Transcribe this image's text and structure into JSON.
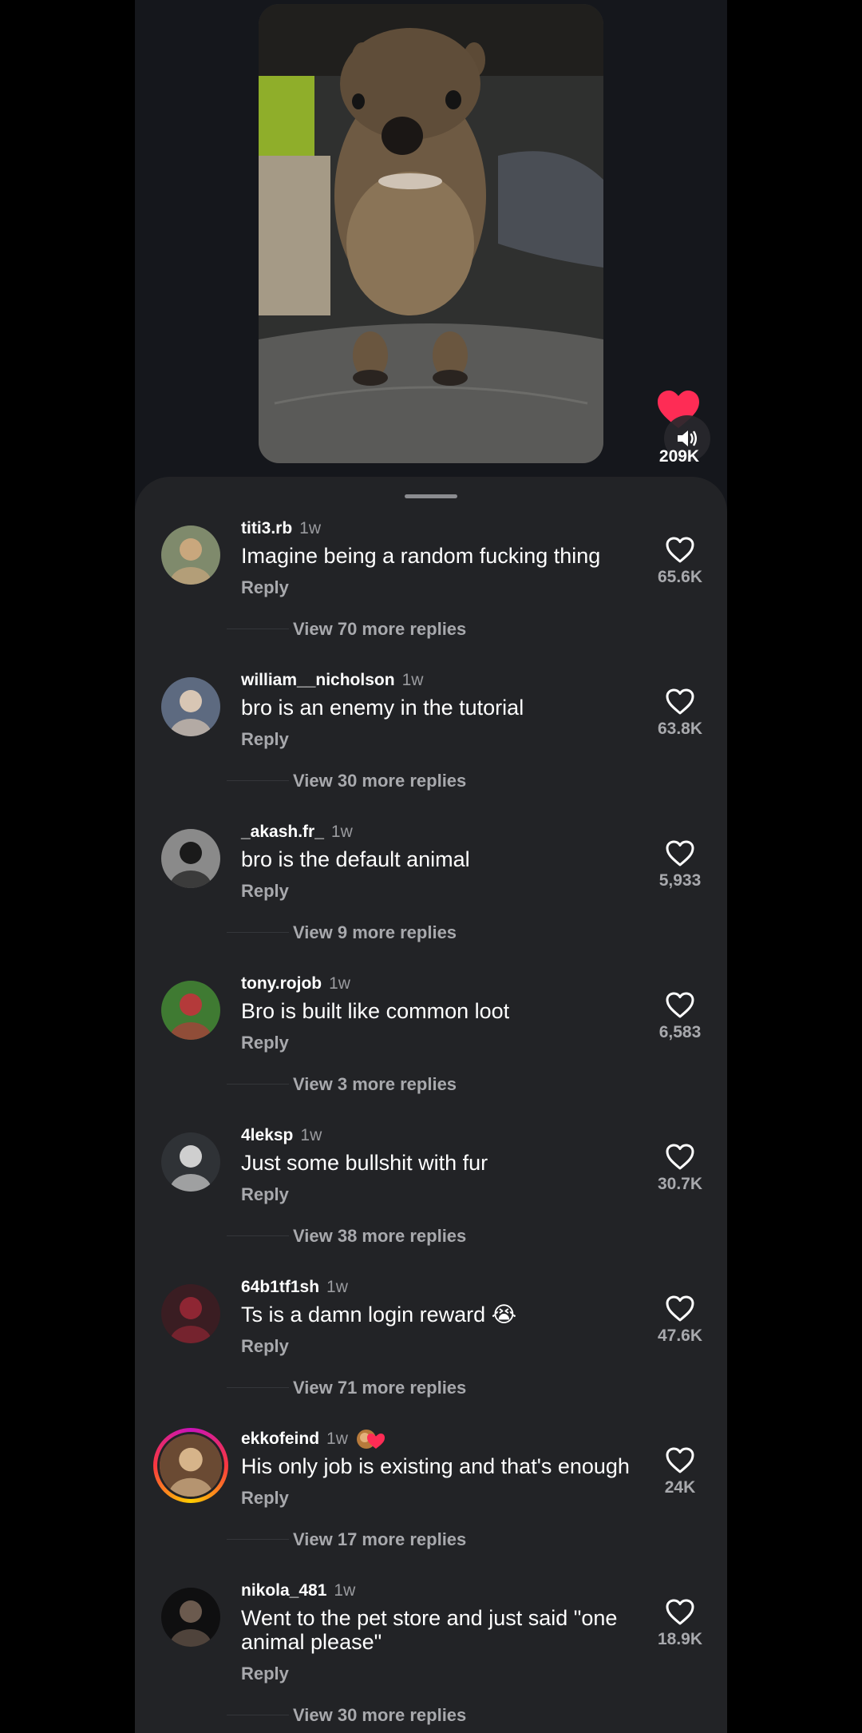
{
  "video": {
    "likes": "209K",
    "icons": {
      "heart": "heart-icon",
      "sound": "speaker-icon"
    },
    "colors": {
      "heart": "#fe2c55"
    }
  },
  "comments": [
    {
      "user": "titi3.rb",
      "time": "1w",
      "text": "Imagine being a random fucking thing",
      "reply": "Reply",
      "likes": "65.6K",
      "view_more": "View 70 more replies"
    },
    {
      "user": "william__nicholson",
      "time": "1w",
      "text": "bro is an enemy in the tutorial",
      "reply": "Reply",
      "likes": "63.8K",
      "view_more": "View 30 more replies"
    },
    {
      "user": "_akash.fr_",
      "time": "1w",
      "text": "bro is the default animal",
      "reply": "Reply",
      "likes": "5,933",
      "view_more": "View 9 more replies"
    },
    {
      "user": "tony.rojob",
      "time": "1w",
      "text": "Bro is built like common loot",
      "reply": "Reply",
      "likes": "6,583",
      "view_more": "View 3 more replies"
    },
    {
      "user": "4leksp",
      "time": "1w",
      "text": "Just some bullshit with fur",
      "reply": "Reply",
      "likes": "30.7K",
      "view_more": "View 38 more replies"
    },
    {
      "user": "64b1tf1sh",
      "time": "1w",
      "text": "Ts is a damn login reward 😭",
      "reply": "Reply",
      "likes": "47.6K",
      "view_more": "View 71 more replies"
    },
    {
      "user": "ekkofeind",
      "time": "1w",
      "text": "His only job is existing and that's enough",
      "reply": "Reply",
      "likes": "24K",
      "view_more": "View 17 more replies"
    },
    {
      "user": "nikola_481",
      "time": "1w",
      "text": "Went to the pet store and just said \"one animal please\"",
      "reply": "Reply",
      "likes": "18.9K",
      "view_more": "View 30 more replies"
    }
  ]
}
